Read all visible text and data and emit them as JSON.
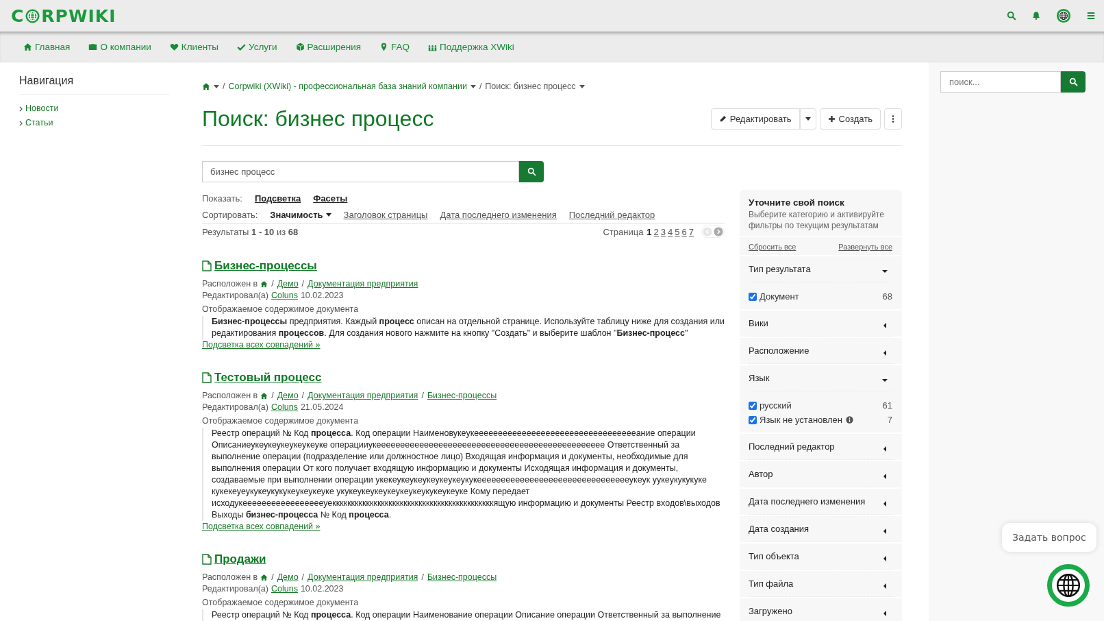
{
  "header": {
    "logo_start": "C",
    "logo_end": "RPWIKI"
  },
  "nav": [
    {
      "label": "Главная",
      "kind": "home"
    },
    {
      "label": "О компании",
      "kind": "briefcase"
    },
    {
      "label": "Клиенты",
      "kind": "heart"
    },
    {
      "label": "Услуги",
      "kind": "check"
    },
    {
      "label": "Расширения",
      "kind": "cube"
    },
    {
      "label": "FAQ",
      "kind": "pin"
    },
    {
      "label": "Поддержка XWiki",
      "kind": "people"
    }
  ],
  "sidebar": {
    "title": "Навигация",
    "items": [
      "Новости",
      "Статьи"
    ]
  },
  "breadcrumb": [
    {
      "sep": "/",
      "label": "Corpwiki (XWiki) - профессиональная база знаний компании"
    },
    {
      "sep": "/",
      "label": "Поиск: бизнес процесс"
    }
  ],
  "title": "Поиск: бизнес процесс",
  "actions": {
    "edit": "Редактировать",
    "create": "Создать"
  },
  "search": {
    "value": "бизнес процесс"
  },
  "show": {
    "label": "Показать:",
    "options": [
      "Подсветка",
      "Фасеты"
    ]
  },
  "sort": {
    "label": "Сортировать:",
    "options": [
      {
        "label": "Значимость",
        "selected": true
      },
      {
        "label": "Заголовок страницы",
        "selected": false
      },
      {
        "label": "Дата последнего изменения",
        "selected": false
      },
      {
        "label": "Последний редактор",
        "selected": false
      }
    ]
  },
  "results_summary": "Результаты **1 - 10** из **68**",
  "pagination": {
    "label": "Страница",
    "pages": [
      {
        "label": "1",
        "selected": true
      },
      {
        "label": "2",
        "selected": false
      },
      {
        "label": "3",
        "selected": false
      },
      {
        "label": "4",
        "selected": false
      },
      {
        "label": "5",
        "selected": false
      },
      {
        "label": "6",
        "selected": false
      },
      {
        "label": "7",
        "selected": false
      }
    ],
    "arrows": [
      {
        "kind": "prev",
        "disabled": true
      },
      {
        "kind": "next",
        "disabled": false
      }
    ]
  },
  "results": [
    {
      "title": "Бизнес-процессы",
      "location_label": "Расположен в",
      "path": [
        {
          "sep": "/",
          "label": "Демо"
        },
        {
          "sep": "/",
          "label": "Документация предприятия"
        }
      ],
      "edited_label": "Редактировал(а)",
      "author": "Coluns",
      "date": "10.02.2023",
      "content_label": "Отображаемое содержимое документа",
      "snippet": "**Бизнес-процессы** предприятия. Каждый **процесс** описан на отдельной странице. Используйте таблицу ниже для создания или редактирования **процессов**. Для создания нового нажмите на кнопку \"Создать\" и выберите шаблон \"**Бизнес-процесс**\"",
      "more": "Подсветка всех совпадений »"
    },
    {
      "title": "Тестовый процесс",
      "location_label": "Расположен в",
      "path": [
        {
          "sep": "/",
          "label": "Демо"
        },
        {
          "sep": "/",
          "label": "Документация предприятия"
        },
        {
          "sep": "/",
          "label": "Бизнес-процессы"
        }
      ],
      "edited_label": "Редактировал(а)",
      "author": "Coluns",
      "date": "21.05.2024",
      "content_label": "Отображаемое содержимое документа",
      "snippet": "Реестр операций № Код **процесса**. Код операции Наименовукеукееееееееееееееееееееееееееееееееееание операции Описаниеукеукеукеукеукеуке операцииукееееееееееееееееееееееееееееееееееееееееееееееее Ответственный за выполнение операции (подразделение или должностное лицо) Входящая информация и документы, необходимые для выполнения операции От кого получает входящую информацию и документы Исходящая информация и документы, создаваемые при выполнении операции укекеукеукеукеукеукеукукееееееееееееееееееееееееееееееееукеук уукеукукукуке кукекеуеукукеукукукеукеукеуке укукеукеукеукеукеукеукукеукеуке Кому передает исходукеееееееееееееееееуекккккккккккккккккккккккккккккккккккккккккккящую информацию и документы Реестр входов\\выходов Выходы **бизнес-процесса** № Код **процесса**.",
      "more": "Подсветка всех совпадений »"
    },
    {
      "title": "Продажи",
      "location_label": "Расположен в",
      "path": [
        {
          "sep": "/",
          "label": "Демо"
        },
        {
          "sep": "/",
          "label": "Документация предприятия"
        },
        {
          "sep": "/",
          "label": "Бизнес-процессы"
        }
      ],
      "edited_label": "Редактировал(а)",
      "author": "Coluns",
      "date": "10.02.2023",
      "content_label": "Отображаемое содержимое документа",
      "snippet": "Реестр операций № Код **процесса**. Код операции Наименование операции Описание операции Ответственный за выполнение"
    }
  ],
  "facets": {
    "title": "Уточните свой поиск",
    "subtitle": "Выберите категорию и активируйте фильтры по текущим результатам",
    "reset": "Сбросить все",
    "expand": "Развернуть все",
    "groups": [
      {
        "title": "Тип результата",
        "expanded": true,
        "items": [
          {
            "label": "Документ",
            "count": "68",
            "checked": true
          }
        ]
      },
      {
        "title": "Вики",
        "expanded": false
      },
      {
        "title": "Расположение",
        "expanded": false
      },
      {
        "title": "Язык",
        "expanded": true,
        "items": [
          {
            "label": "русский",
            "count": "61",
            "checked": true
          },
          {
            "label": "Язык не установлен",
            "count": "7",
            "checked": true,
            "info": true
          }
        ]
      },
      {
        "title": "Последний редактор",
        "expanded": false
      },
      {
        "title": "Автор",
        "expanded": false
      },
      {
        "title": "Дата последнего изменения",
        "expanded": false
      },
      {
        "title": "Дата создания",
        "expanded": false
      },
      {
        "title": "Тип объекта",
        "expanded": false
      },
      {
        "title": "Тип файла",
        "expanded": false
      },
      {
        "title": "Загружено",
        "expanded": false
      }
    ]
  },
  "side_search": {
    "placeholder": "поиск..."
  },
  "chat": {
    "label": "Задать вопрос"
  }
}
